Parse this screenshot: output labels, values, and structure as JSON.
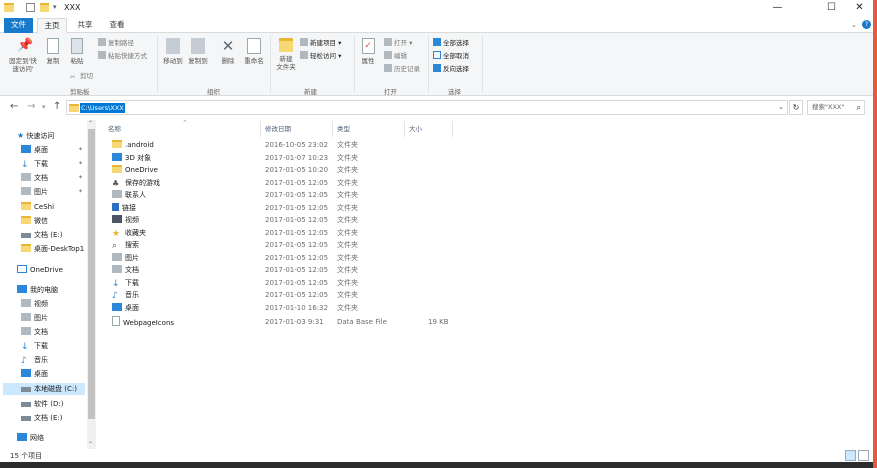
{
  "window": {
    "title": "XXX",
    "minimize": "—",
    "maximize": "☐",
    "close": "✕"
  },
  "ribbon_tabs": {
    "file": "文件",
    "home": "主页",
    "share": "共享",
    "view": "查看"
  },
  "ribbon": {
    "pin_quick_access": "固定到'快\n速访问'",
    "copy": "复制",
    "paste": "粘贴",
    "copy_path": "复制路径",
    "paste_shortcut": "粘贴快捷方式",
    "cut": "剪切",
    "group_clipboard": "剪贴板",
    "move_to": "移动到",
    "copy_to": "复制到",
    "delete": "删除",
    "rename": "重命名",
    "group_organize": "组织",
    "new_folder": "新建\n文件夹",
    "new_item": "新建项目",
    "easy_access": "轻松访问",
    "group_new": "新建",
    "properties": "属性",
    "open": "打开",
    "edit": "编辑",
    "history": "历史记录",
    "group_open": "打开",
    "select_all": "全部选择",
    "select_none": "全部取消",
    "invert_selection": "反向选择",
    "group_select": "选择"
  },
  "address": {
    "path": "C:\\Users\\XXX",
    "search_placeholder": "搜索\"XXX\""
  },
  "nav_pane": {
    "quick_access": "快速访问",
    "items": [
      {
        "label": "桌面",
        "pinned": true
      },
      {
        "label": "下载",
        "pinned": true
      },
      {
        "label": "文档",
        "pinned": true
      },
      {
        "label": "图片",
        "pinned": true
      },
      {
        "label": "CeShi",
        "pinned": false
      },
      {
        "label": "微信",
        "pinned": false
      },
      {
        "label": "文档 (E:)",
        "pinned": false
      },
      {
        "label": "桌面-DeskTop1",
        "pinned": false
      }
    ],
    "onedrive": "OneDrive",
    "this_pc": "我的电脑",
    "pc_items": [
      "视频",
      "图片",
      "文档",
      "下载",
      "音乐",
      "桌面",
      "本地磁盘 (C:)",
      "软件 (D:)",
      "文档 (E:)"
    ],
    "network": "网络"
  },
  "columns": {
    "name": "名称",
    "date": "修改日期",
    "type": "类型",
    "size": "大小"
  },
  "files": [
    {
      "name": ".android",
      "date": "2016-10-05 23:02",
      "type": "文件夹",
      "size": ""
    },
    {
      "name": "3D 对象",
      "date": "2017-01-07 10:23",
      "type": "文件夹",
      "size": ""
    },
    {
      "name": "OneDrive",
      "date": "2017-01-05 10:20",
      "type": "文件夹",
      "size": ""
    },
    {
      "name": "保存的游戏",
      "date": "2017-01-05 12:05",
      "type": "文件夹",
      "size": ""
    },
    {
      "name": "联系人",
      "date": "2017-01-05 12:05",
      "type": "文件夹",
      "size": ""
    },
    {
      "name": "链接",
      "date": "2017-01-05 12:05",
      "type": "文件夹",
      "size": ""
    },
    {
      "name": "视频",
      "date": "2017-01-05 12:05",
      "type": "文件夹",
      "size": ""
    },
    {
      "name": "收藏夹",
      "date": "2017-01-05 12:05",
      "type": "文件夹",
      "size": ""
    },
    {
      "name": "搜索",
      "date": "2017-01-05 12:05",
      "type": "文件夹",
      "size": ""
    },
    {
      "name": "图片",
      "date": "2017-01-05 12:05",
      "type": "文件夹",
      "size": ""
    },
    {
      "name": "文档",
      "date": "2017-01-05 12:05",
      "type": "文件夹",
      "size": ""
    },
    {
      "name": "下载",
      "date": "2017-01-05 12:05",
      "type": "文件夹",
      "size": ""
    },
    {
      "name": "音乐",
      "date": "2017-01-05 12:05",
      "type": "文件夹",
      "size": ""
    },
    {
      "name": "桌面",
      "date": "2017-01-10 16:32",
      "type": "文件夹",
      "size": ""
    },
    {
      "name": "WebpageIcons",
      "date": "2017-01-03 9:31",
      "type": "Data Base File",
      "size": "19 KB"
    }
  ],
  "status": {
    "item_count": "15 个项目"
  }
}
